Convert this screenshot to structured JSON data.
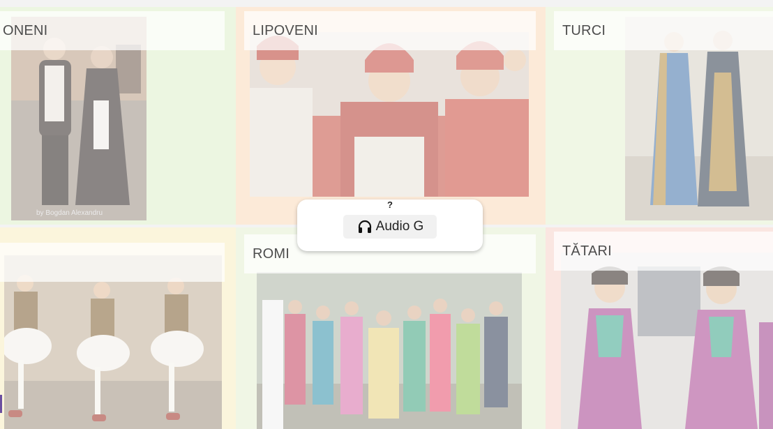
{
  "cards": [
    {
      "id": "sarbi",
      "label": "ONENI",
      "bg": "#dcefc9"
    },
    {
      "id": "lipoveni",
      "label": "LIPOVENI",
      "bg": "#f9d9b9"
    },
    {
      "id": "turci",
      "label": "TURCI",
      "bg": "#e3f0cf"
    },
    {
      "id": "aromani",
      "label": "",
      "bg": "#f8edc0"
    },
    {
      "id": "romi",
      "label": "ROMI",
      "bg": "#e3efcf"
    },
    {
      "id": "tatari",
      "label": "TĂTARI",
      "bg": "#f6d2c8"
    }
  ],
  "photo_credit": "by Bogdan Alexandru",
  "popup": {
    "question": "?",
    "audio_label": "Audio G",
    "audio_icon": "headphones-icon"
  },
  "colors": {
    "accent": "#6b4fa0"
  }
}
